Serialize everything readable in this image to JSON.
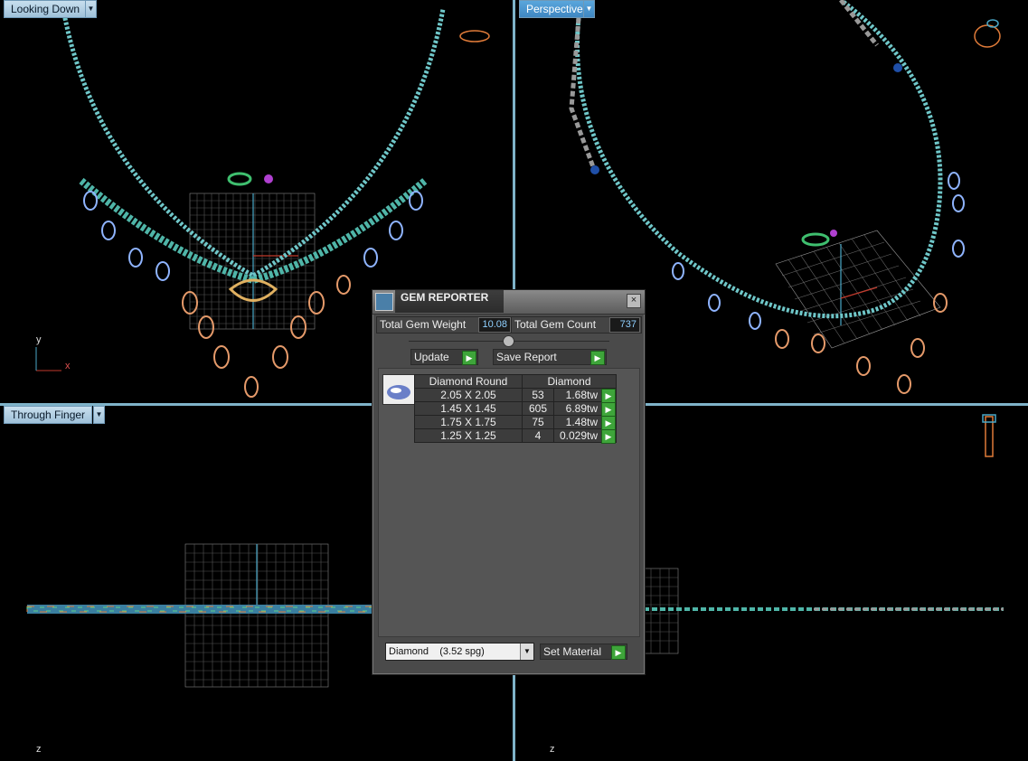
{
  "viewports": {
    "top_left": {
      "label": "Looking Down",
      "axis_y": "y",
      "axis_x": "x"
    },
    "top_right": {
      "label": "Perspective"
    },
    "bottom_left": {
      "label": "Through Finger",
      "axis_z": "z"
    },
    "bottom_right": {
      "axis_z": "z"
    }
  },
  "gem_reporter": {
    "title": "GEM REPORTER",
    "close_glyph": "×",
    "total_weight_label": "Total Gem Weight",
    "total_weight_value": "10.08",
    "total_count_label": "Total Gem Count",
    "total_count_value": "737",
    "update_label": "Update",
    "save_report_label": "Save Report",
    "table": {
      "header_shape": "Diamond Round",
      "header_material": "Diamond",
      "rows": [
        {
          "size": "2.05 X 2.05",
          "count": "53",
          "weight": "1.68tw"
        },
        {
          "size": "1.45 X 1.45",
          "count": "605",
          "weight": "6.89tw"
        },
        {
          "size": "1.75 X 1.75",
          "count": "75",
          "weight": "1.48tw"
        },
        {
          "size": "1.25 X 1.25",
          "count": "4",
          "weight": "0.029tw"
        }
      ]
    },
    "material_select": "Diamond    (3.52 spg)",
    "set_material_label": "Set Material"
  },
  "icons": {
    "dropdown": "chevron-down-icon",
    "go": "play-arrow-icon"
  },
  "colors": {
    "viewport_active": "#4a95d0",
    "viewport_label": "#b4d2e6",
    "go_button": "#3ea53a"
  }
}
